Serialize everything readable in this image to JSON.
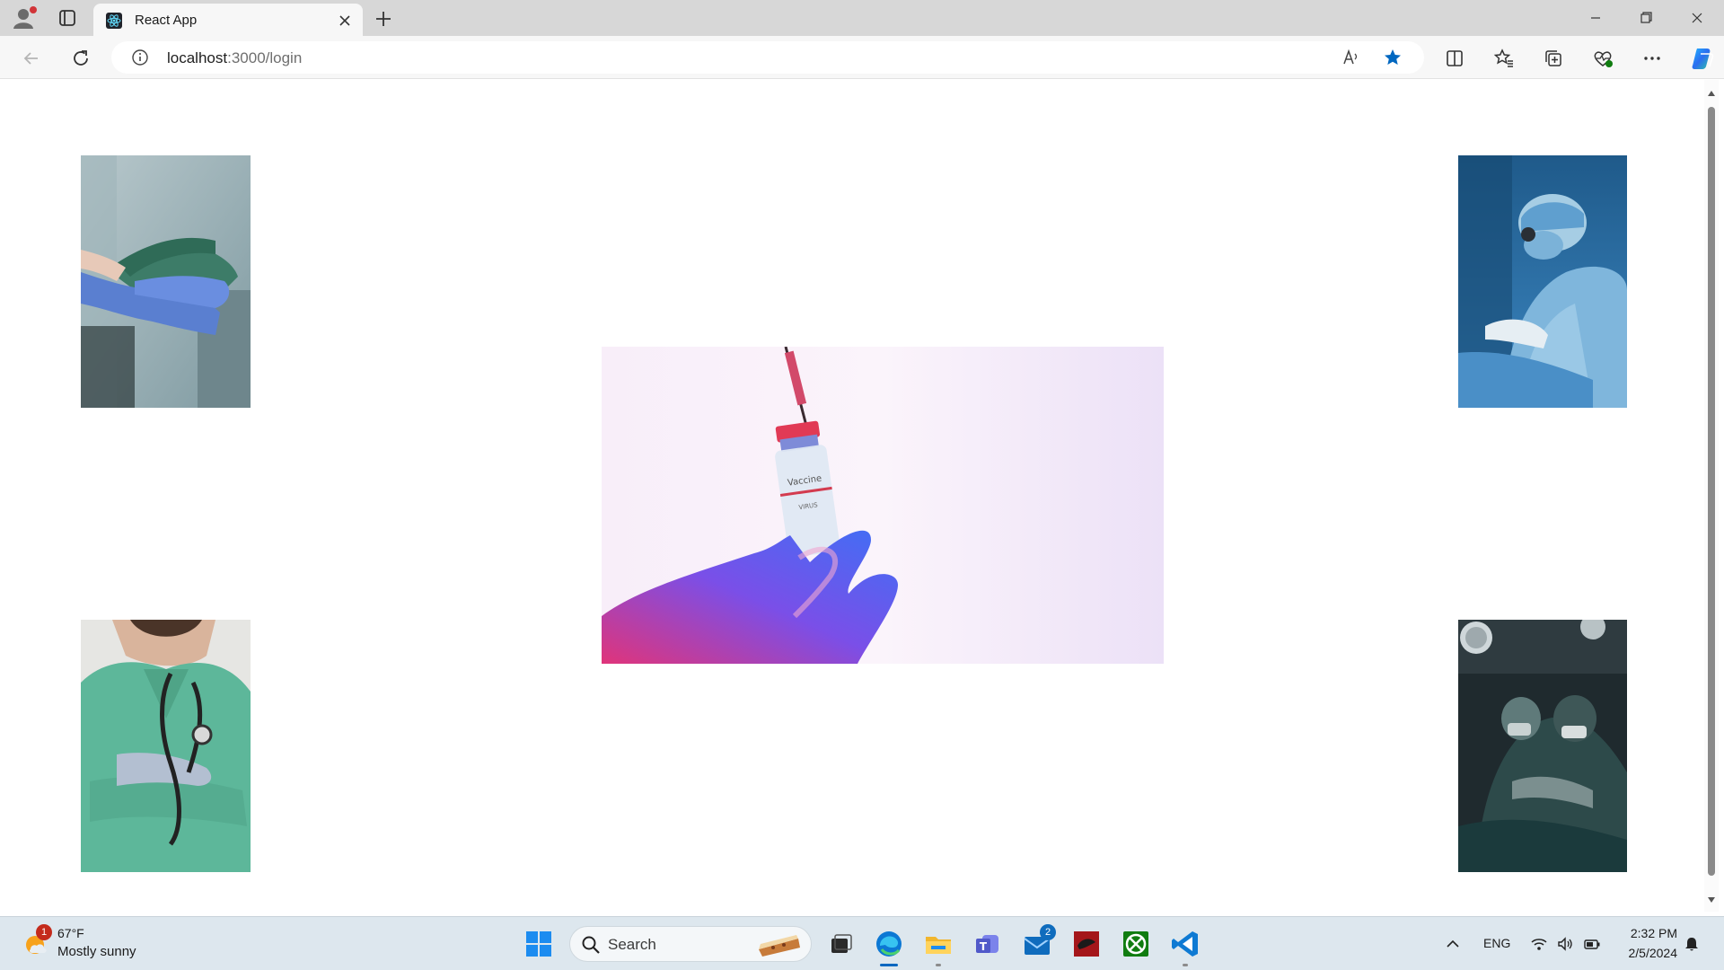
{
  "browser": {
    "tab_title": "React App",
    "url_host": "localhost",
    "url_rest": ":3000/login",
    "icons": {
      "profile": "profile-icon",
      "tabs": "vertical-tabs-icon",
      "close_tab": "close-icon",
      "new_tab": "plus-icon",
      "back": "back-arrow-icon",
      "refresh": "refresh-icon",
      "info": "info-icon",
      "read_aloud": "read-aloud-icon",
      "favorite": "star-icon",
      "split": "split-screen-icon",
      "favorites": "favorites-icon",
      "collections": "collections-icon",
      "performance": "heart-pulse-icon",
      "more": "more-icon",
      "copilot": "copilot-icon"
    }
  },
  "page": {
    "images": [
      {
        "name": "gloved-hands-photo",
        "subject": "gloved hands holding"
      },
      {
        "name": "surgeon-photo",
        "subject": "surgeon operating"
      },
      {
        "name": "vaccine-vial-photo",
        "subject": "gloved hand holding vaccine vial"
      },
      {
        "name": "doctor-stethoscope-photo",
        "subject": "doctor with stethoscope"
      },
      {
        "name": "operating-room-photo",
        "subject": "surgeons in operating room"
      }
    ],
    "vial_label_1": "Vaccine",
    "vial_label_2": "VIRUS"
  },
  "taskbar": {
    "weather_badge": "1",
    "temperature": "67°F",
    "weather": "Mostly sunny",
    "search_placeholder": "Search",
    "mail_badge": "2",
    "language": "ENG",
    "time": "2:32 PM",
    "date": "2/5/2024",
    "colors": {
      "accent": "#0067c0",
      "badge": "#c42b1c"
    }
  }
}
